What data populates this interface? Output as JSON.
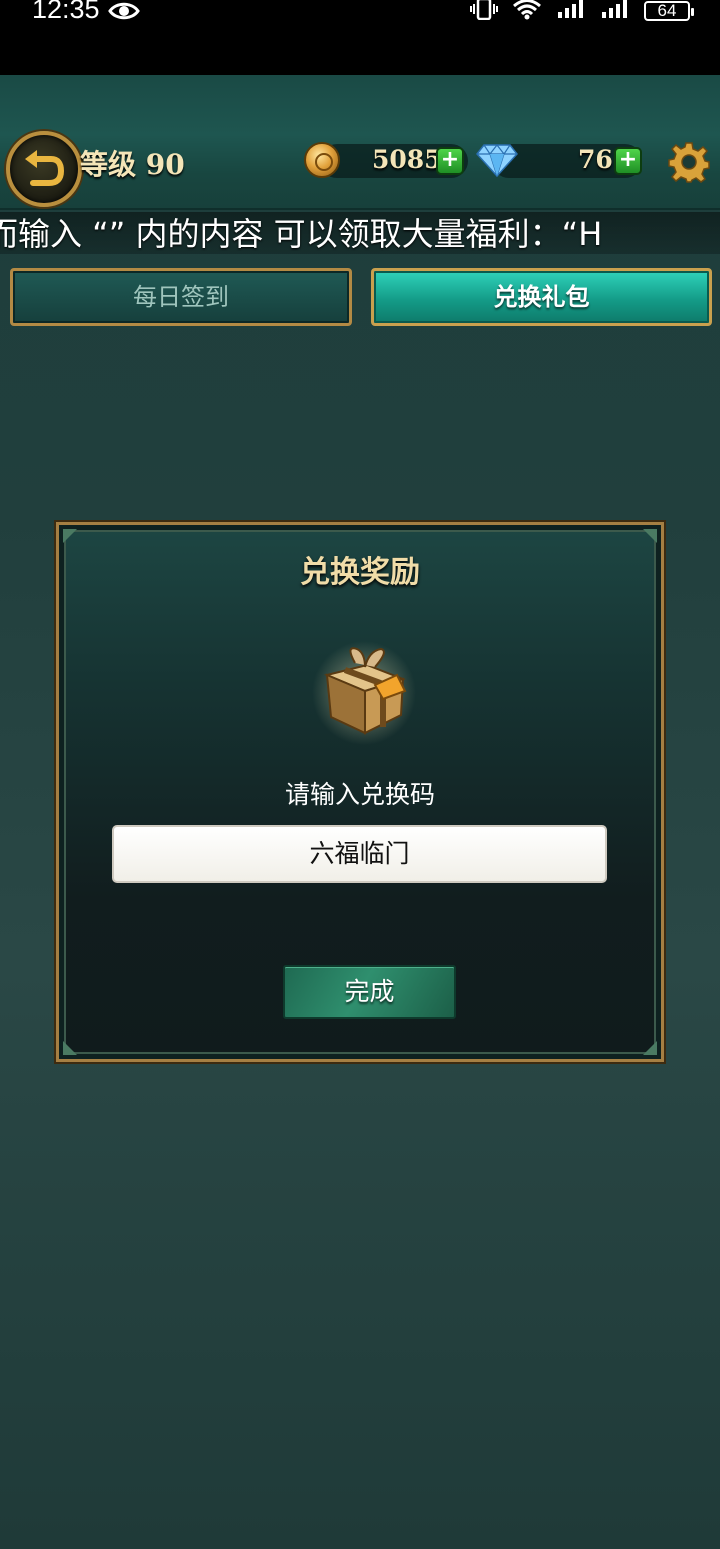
{
  "status_bar": {
    "time": "12:35",
    "battery": "64"
  },
  "header": {
    "level_label": "等级 90",
    "coins": "5085",
    "gems": "76",
    "plus": "+"
  },
  "marquee": {
    "text": "而输入 “” 内的内容 可以领取大量福利：“H"
  },
  "tabs": [
    {
      "label": "每日签到",
      "selected": false
    },
    {
      "label": "兑换礼包",
      "selected": true
    }
  ],
  "dialog": {
    "title": "兑换奖励",
    "prompt": "请输入兑换码",
    "code_value": "六福临门",
    "done_label": "完成"
  },
  "colors": {
    "gold_text": "#f0dca8",
    "tab_active": "#149c88",
    "frame_gold": "#a57f43"
  }
}
